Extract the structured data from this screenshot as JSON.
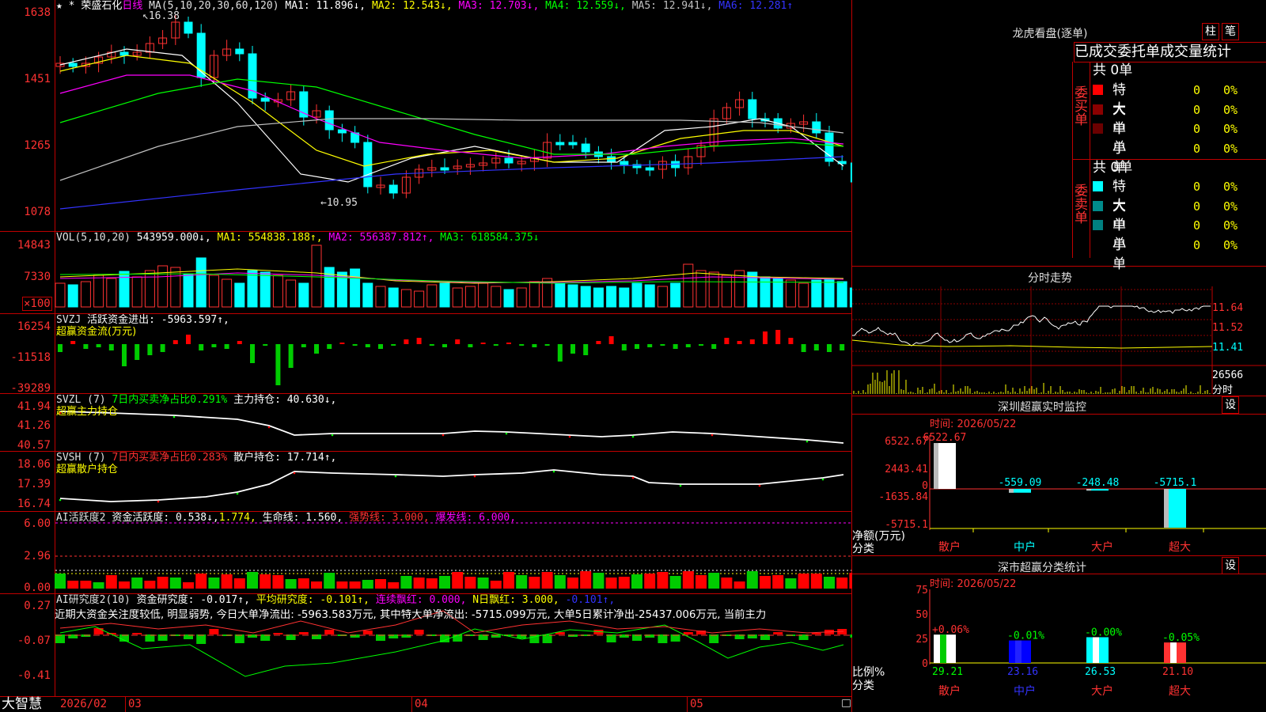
{
  "stock": {
    "star": "★",
    "asterisk": "*",
    "name": "荣盛石化",
    "period": "日线",
    "ma_label": "MA(5,10,20,30,60,120)",
    "ma1": "MA1: 11.896↓,",
    "ma2": "MA2: 12.543↓,",
    "ma3": "MA3: 12.703↓,",
    "ma4": "MA4: 12.559↓,",
    "ma5": "MA5: 12.941↓,",
    "ma6": "MA6: 12.281↑",
    "high_marker": "16.38",
    "low_marker": "←10.95"
  },
  "price_axis": [
    "1638",
    "1451",
    "1265",
    "1078"
  ],
  "vol": {
    "label": "VOL(5,10,20)",
    "value": "543959.000↓,",
    "ma1": "MA1: 554838.188↑,",
    "ma2": "MA2: 556387.812↑,",
    "ma3": "MA3: 618584.375↓",
    "axis": [
      "14843",
      "7330"
    ],
    "unit": "×100"
  },
  "svzj": {
    "label": "SVZJ",
    "text": "活跃资金进出: -5963.597↑,",
    "sub": "超赢资金流(万元)",
    "axis": [
      "16254",
      "-11518",
      "-39289"
    ]
  },
  "svzl": {
    "label": "SVZL (7)",
    "text1": "7日内买卖净占比0.291%",
    "text2": "主力持仓: 40.630↓,",
    "sub": "超赢主力持仓",
    "axis": [
      "41.94",
      "41.26",
      "40.57"
    ]
  },
  "svsh": {
    "label": "SVSH (7)",
    "text1": "7日内买卖净占比0.283%",
    "text2": "散户持仓: 17.714↑,",
    "sub": "超赢散户持仓",
    "axis": [
      "18.06",
      "17.39",
      "16.74"
    ]
  },
  "ai1": {
    "label": "AI活跃度2",
    "text1": "资金活跃度: 0.538↓,",
    "text1b": "1.774,",
    "text2": "生命线: 1.560,",
    "text3": "强势线: 3.000,",
    "text4": "爆发线: 6.000,",
    "axis": [
      "6.00",
      "2.96",
      "0.00"
    ]
  },
  "ai2": {
    "label": "AI研究度2(10)",
    "text1": "资金研究度: -0.017↑,",
    "text2": "平均研究度: -0.101↑,",
    "text3": "连续飘红: 0.000,",
    "text4": "N日飘红: 3.000,",
    "text5": "-0.101↑,",
    "comment": "近期大资金关注度较低, 明显弱势, 今日大单净流出: -5963.583万元, 其中特大单净流出: -5715.099万元, 大单5日累计净出-25437.006万元, 当前主力",
    "axis": [
      "0.27",
      "-0.07",
      "-0.41"
    ]
  },
  "bottom": {
    "brand": "大智慧",
    "dates": [
      "2026/02",
      "03",
      "04",
      "05"
    ]
  },
  "dragon": {
    "title": "龙虎看盘(逐单)",
    "btn1": "柱",
    "btn2": "笔",
    "tabs": "已成交委托单成交量统计",
    "buy_total": "共 0单",
    "sell_total": "共 0单",
    "buy_side": "委买单",
    "sell_side": "委卖单",
    "buy_rows": [
      {
        "name": "特大",
        "count": "0",
        "pct": "0%",
        "color": "#ff0000"
      },
      {
        "name": "大单",
        "count": "0",
        "pct": "0%",
        "color": "#8b0000"
      },
      {
        "name": "中单",
        "count": "0",
        "pct": "0%",
        "color": "#6b0000"
      },
      {
        "name": "小单",
        "count": "0",
        "pct": "0%",
        "color": ""
      }
    ],
    "sell_rows": [
      {
        "name": "特大",
        "count": "0",
        "pct": "0%",
        "color": "#00ffff"
      },
      {
        "name": "大单",
        "count": "0",
        "pct": "0%",
        "color": "#008b8b"
      },
      {
        "name": "中单",
        "count": "0",
        "pct": "0%",
        "color": "#008080"
      },
      {
        "name": "小单",
        "count": "0",
        "pct": "0%",
        "color": ""
      }
    ]
  },
  "intraday": {
    "title": "分时走势",
    "axis": [
      "11.64",
      "11.52",
      "11.41",
      "26566"
    ],
    "vol_label": "分时"
  },
  "monitor": {
    "title": "深圳超赢实时监控",
    "btn": "设",
    "time": "时间: 2026/05/22",
    "axis": [
      "6522.67",
      "2443.41",
      "0",
      "-1635.84",
      "-5715.1"
    ],
    "ylabel": "净额(万元)",
    "xlabel": "分类",
    "bars": [
      {
        "cat": "散户",
        "value": 6522.67,
        "label": "6522.67"
      },
      {
        "cat": "中户",
        "value": -559.09,
        "label": "-559.09"
      },
      {
        "cat": "大户",
        "value": -248.48,
        "label": "-248.48"
      },
      {
        "cat": "超大",
        "value": -5715.1,
        "label": "-5715.1"
      }
    ]
  },
  "classify": {
    "title": "深市超赢分类统计",
    "btn": "设",
    "time": "时间: 2026/05/22",
    "axis": [
      "75",
      "50",
      "25",
      "0"
    ],
    "ylabel": "比例%",
    "xlabel": "分类",
    "bars": [
      {
        "cat": "散户",
        "value": 29.21,
        "label": "29.21",
        "delta": "+0.06%"
      },
      {
        "cat": "中户",
        "value": 23.16,
        "label": "23.16",
        "delta": "-0.01%"
      },
      {
        "cat": "大户",
        "value": 26.53,
        "label": "26.53",
        "delta": "-0.00%"
      },
      {
        "cat": "超大",
        "value": 21.1,
        "label": "21.10",
        "delta": "-0.05%"
      }
    ]
  }
}
